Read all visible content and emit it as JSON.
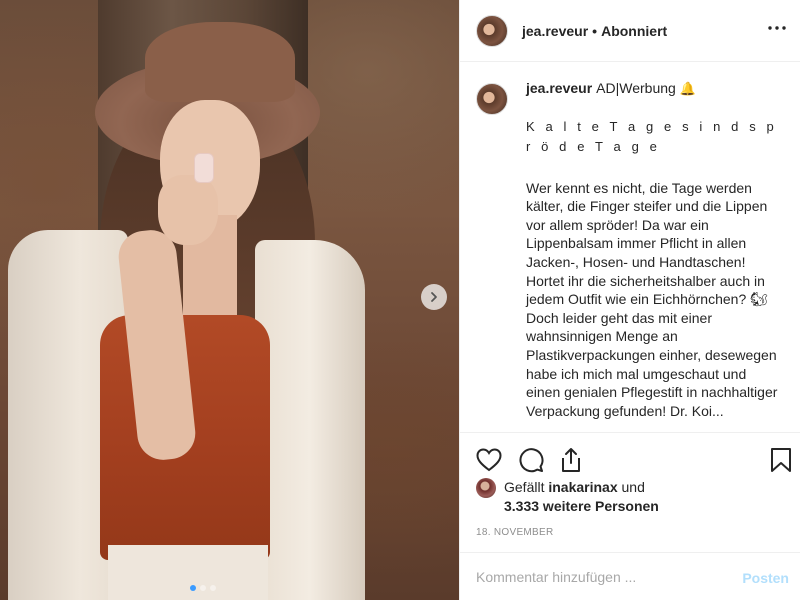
{
  "header": {
    "username": "jea.reveur",
    "separator": "•",
    "follow_status": "Abonniert"
  },
  "caption": {
    "username": "jea.reveur",
    "tag": "AD|Werbung",
    "tag_emoji": "🔔",
    "spaced_line": "K a l t e T a g e s i n d s p r ö d e T a g e",
    "text": "Wer kennt es nicht, die Tage werden kälter, die Finger steifer und die Lippen vor allem spröder! Da war ein Lippenbalsam immer Pflicht in allen Jacken-, Hosen- und Handtaschen! Hortet ihr die sicherheitshalber auch in jedem Outfit wie ein Eichhörnchen? 🐿 Doch leider geht das mit einer wahnsinnigen Menge an Plastikverpackungen einher, desewegen habe ich mich mal umgeschaut und einen genialen Pflegestift in nachhaltiger Verpackung gefunden! Dr. Koi..."
  },
  "likes": {
    "prefix": "Gefällt",
    "user": "inakarinax",
    "connector": "und",
    "others": "3.333 weitere Personen"
  },
  "date": "18. NOVEMBER",
  "comment": {
    "placeholder": "Kommentar hinzufügen ...",
    "post_label": "Posten"
  },
  "carousel": {
    "slide_count": 3,
    "active_index": 0
  },
  "colors": {
    "accent_blue": "#3b9bff",
    "post_disabled": "#b2dffc",
    "text": "#262626",
    "muted": "#8e8e8e",
    "border": "#efefef"
  },
  "icons": {
    "like": "heart-icon",
    "comment": "comment-icon",
    "share": "share-icon",
    "save": "bookmark-icon",
    "more": "more-icon",
    "next": "chevron-right-icon"
  }
}
